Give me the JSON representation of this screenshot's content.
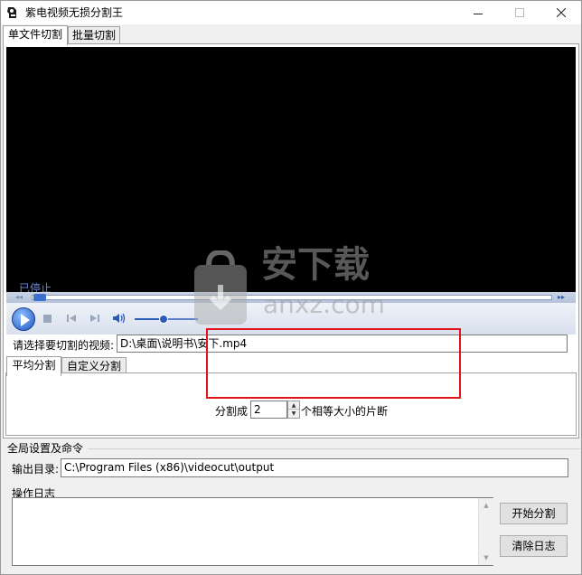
{
  "window": {
    "title": "紫电视频无损分割王",
    "icon": "app-icon"
  },
  "tabs": [
    {
      "label": "单文件切割",
      "active": true
    },
    {
      "label": "批量切割",
      "active": false
    }
  ],
  "player": {
    "status": "已停止",
    "seek_left_label": "◂◂",
    "seek_right_label": "▸▸",
    "volume_level": 0.45
  },
  "file_select": {
    "label": "请选择要切割的视频:",
    "value": "D:\\桌面\\说明书\\安下.mp4"
  },
  "split_tabs": [
    {
      "label": "平均分割",
      "active": true
    },
    {
      "label": "自定义分割",
      "active": false
    }
  ],
  "split": {
    "prefix": "分割成",
    "value": "2",
    "suffix": "个相等大小的片断"
  },
  "global": {
    "title": "全局设置及命令",
    "output_label": "输出目录:",
    "output_value": "C:\\Program Files (x86)\\videocut\\output",
    "log_label": "操作日志",
    "start_button": "开始分割",
    "clear_button": "清除日志"
  },
  "watermark": {
    "cn": "安下载",
    "en": "anxz.com"
  }
}
